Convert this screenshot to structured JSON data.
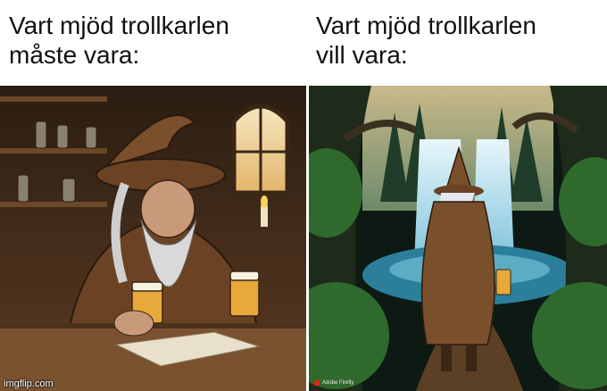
{
  "captions": {
    "left": "Vart mjöd trollkarlen\nmåste vara:",
    "right": "Vart mjöd trollkarlen\nvill vara:"
  },
  "watermark": "imgflip.com",
  "firefly_badge": "Adobe Firefly",
  "colors": {
    "tavern_wood": "#5a3b22",
    "wizard_robe": "#7a4f2b",
    "beard": "#d9d9d9",
    "mead": "#e8a93a",
    "forest": "#1f4a2a",
    "waterfall": "#cfe9f2"
  },
  "images": {
    "left": "wizard-in-tavern-illustration",
    "right": "wizard-in-forest-by-waterfall-illustration"
  }
}
